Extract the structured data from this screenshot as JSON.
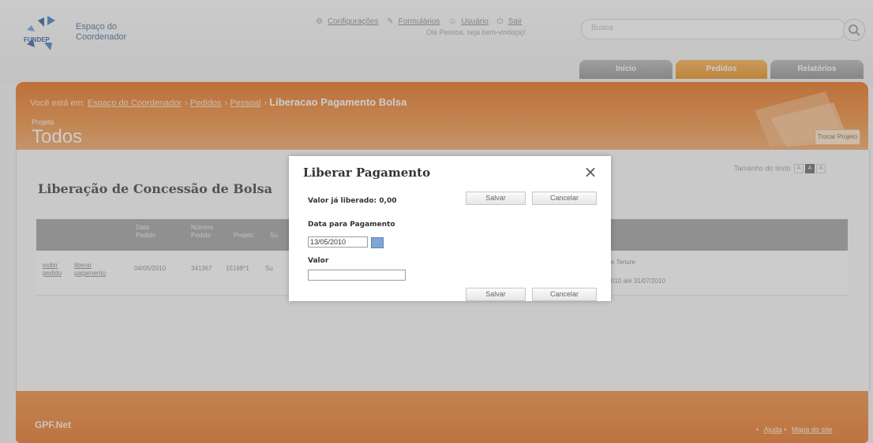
{
  "brand": {
    "name_line1": "Espaço do",
    "name_line2": "Coordenador",
    "logo_text": "FUNDEP"
  },
  "toplinks": [
    "Configurações",
    "Formulários",
    "Usuário",
    "Sair"
  ],
  "welcome": "Olá Pessoa, seja bem-vindo(a)!",
  "search": {
    "placeholder": "Busca"
  },
  "nav": {
    "inicio": "Início",
    "pedidos": "Pedidos",
    "relatorios": "Relatórios"
  },
  "breadcrumb": {
    "prefix": "Você está em:",
    "links": [
      "Espaço do Coordenador",
      "Pedidos",
      "Pessoal"
    ],
    "current": "Liberacao Pagamento Bolsa"
  },
  "project": {
    "label": "Projeto",
    "name": "Todos",
    "change_button": "Trocar Projeto"
  },
  "text_size": {
    "label": "Tamanho do texto",
    "options": [
      "A",
      "A",
      "A"
    ]
  },
  "section": {
    "title": "Liberação de Concessão de Bolsa"
  },
  "table": {
    "headers": [
      "",
      "",
      "Data Pedido",
      "Número Pedido",
      "Projeto",
      "Su"
    ],
    "row": [
      "exibir pedido",
      "liberar pagamento",
      "04/05/2010",
      "341367",
      "15168*1",
      "Su",
      "e Tenure",
      "010 até 31/07/2010"
    ]
  },
  "modal": {
    "title": "Liberar Pagamento",
    "close_icon": "close-icon",
    "valor_liberado_label": "Valor já liberado: 0,00",
    "data_label": "Data para Pagamento",
    "data_value": "13/05/2010",
    "valor_label": "Valor",
    "valor_value": "",
    "save_label": "Salvar",
    "cancel_label": "Cancelar"
  },
  "footer": {
    "logo": "GPF.Net",
    "links": [
      "Ajuda",
      "Mapa do site"
    ]
  },
  "colors": {
    "accent": "#e8711e",
    "tab_active": "#e98a14",
    "tab_inactive": "#9a9a9a"
  }
}
